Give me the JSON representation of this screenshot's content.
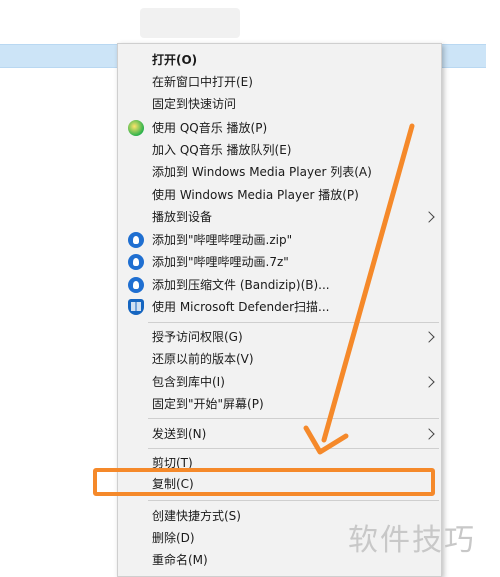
{
  "menu": {
    "items": [
      {
        "label": "打开(O)",
        "bold": true,
        "icon": "",
        "submenu": false
      },
      {
        "label": "在新窗口中打开(E)",
        "icon": "",
        "submenu": false
      },
      {
        "label": "固定到快速访问",
        "icon": "",
        "submenu": false
      },
      {
        "label": "使用 QQ音乐 播放(P)",
        "icon": "qq-music-icon",
        "submenu": false
      },
      {
        "label": "加入 QQ音乐 播放队列(E)",
        "icon": "",
        "submenu": false
      },
      {
        "label": "添加到 Windows Media Player 列表(A)",
        "icon": "",
        "submenu": false
      },
      {
        "label": "使用 Windows Media Player 播放(P)",
        "icon": "",
        "submenu": false
      },
      {
        "label": "播放到设备",
        "icon": "",
        "submenu": true
      },
      {
        "label": "添加到\"哔哩哔哩动画.zip\"",
        "icon": "bandizip-icon",
        "submenu": false
      },
      {
        "label": "添加到\"哔哩哔哩动画.7z\"",
        "icon": "bandizip-icon",
        "submenu": false
      },
      {
        "label": "添加到压缩文件 (Bandizip)(B)...",
        "icon": "bandizip-icon",
        "submenu": false
      },
      {
        "label": "使用 Microsoft Defender扫描...",
        "icon": "defender-shield-icon",
        "submenu": false
      },
      {
        "label": "授予访问权限(G)",
        "icon": "",
        "submenu": true
      },
      {
        "label": "还原以前的版本(V)",
        "icon": "",
        "submenu": false
      },
      {
        "label": "包含到库中(I)",
        "icon": "",
        "submenu": true
      },
      {
        "label": "固定到\"开始\"屏幕(P)",
        "icon": "",
        "submenu": false
      },
      {
        "label": "发送到(N)",
        "icon": "",
        "submenu": true
      },
      {
        "label": "剪切(T)",
        "icon": "",
        "submenu": false
      },
      {
        "label": "复制(C)",
        "icon": "",
        "submenu": false
      },
      {
        "label": "创建快捷方式(S)",
        "icon": "",
        "submenu": false
      },
      {
        "label": "删除(D)",
        "icon": "",
        "submenu": false
      },
      {
        "label": "重命名(M)",
        "icon": "",
        "submenu": false
      }
    ]
  },
  "annotation": {
    "highlight_color": "#f5892a",
    "highlighted_item": "复制(C)"
  },
  "watermark": "软件技巧"
}
